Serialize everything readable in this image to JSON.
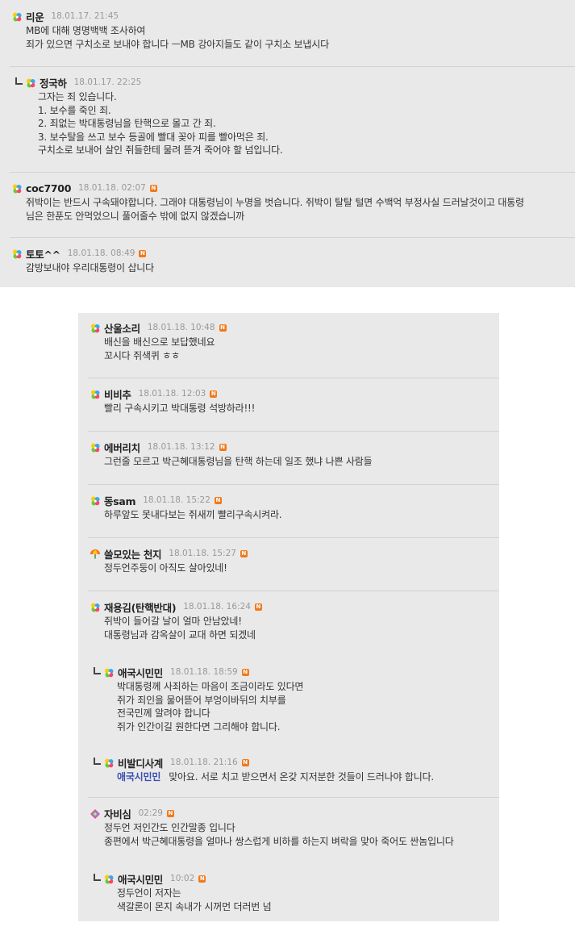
{
  "panel_top": {
    "comments": [
      {
        "nick": "리운",
        "date": "18.01.17. 21:45",
        "new": false,
        "badge": "badge-rainbow-icon",
        "lines": [
          "MB에 대해 명명백백 조사하여",
          "죄가 있으면 구치소로 보내야 합니다 ㅡMB 강아지들도 같이 구치소 보냅시다"
        ]
      },
      {
        "nick": "정국하",
        "date": "18.01.17. 22:25",
        "new": false,
        "badge": "badge-rainbow-icon",
        "reply": true,
        "lines": [
          "그자는 죄 있습니다.",
          "1. 보수를 죽인 죄.",
          "2. 죄없는 박대통령님을 탄핵으로 몰고 간 죄.",
          "3. 보수탈을 쓰고 보수 등골에 빨대 꽂아 피를 빨아먹은 죄.",
          "구치소로 보내어 살인 쥐들한테 물려 뜯겨 죽어야 할 넘입니다."
        ]
      },
      {
        "nick": "coc7700",
        "date": "18.01.18. 02:07",
        "new": true,
        "badge": "badge-rainbow-icon",
        "lines": [
          "쥐박이는 반드시 구속돼야합니다. 그래야 대통령님이 누명을 벗습니다. 쥐박이 탈탈 털면 수백억 부정사실 드러날것이고 대통령",
          "님은 한푼도 안먹었으니 풀어줄수 밖에 없지 않겠습니까"
        ]
      },
      {
        "nick": "토토^^",
        "date": "18.01.18. 08:49",
        "new": true,
        "badge": "badge-rainbow-icon",
        "lines": [
          "감방보내야 우리대통령이 삽니다"
        ]
      }
    ]
  },
  "panel_bottom": {
    "comments": [
      {
        "nick": "산울소리",
        "date": "18.01.18. 10:48",
        "new": true,
        "badge": "badge-rainbow-icon",
        "lines": [
          "배신을 배신으로 보답했네요",
          "꼬시다 쥐색퀴 ㅎㅎ"
        ]
      },
      {
        "nick": "비비추",
        "date": "18.01.18. 12:03",
        "new": true,
        "badge": "badge-rainbow-icon",
        "lines": [
          "빨리 구속시키고 박대통령 석방하라!!!"
        ]
      },
      {
        "nick": "에버리치",
        "date": "18.01.18. 13:12",
        "new": true,
        "badge": "badge-rainbow-icon",
        "lines": [
          "그런줄 모르고 박근혜대통령님을 탄핵 하는데 일조 했냐 나쁜 사람들"
        ]
      },
      {
        "nick": "동sam",
        "date": "18.01.18. 15:22",
        "new": true,
        "badge": "badge-rainbow-icon",
        "lines": [
          "하루앞도 못내다보는 쥐새끼 빨리구속시켜라."
        ]
      },
      {
        "nick": "쓸모있는 천지",
        "date": "18.01.18. 15:27",
        "new": true,
        "badge": "badge-umbrella-icon",
        "lines": [
          "정두언주둥이 아직도 살아있네!"
        ]
      },
      {
        "nick": "재용김(탄핵반대)",
        "date": "18.01.18. 16:24",
        "new": true,
        "badge": "badge-rainbow-icon",
        "lines": [
          "쥐박이 들어갈 날이 얼마 안남았네!",
          "대통령님과 감옥살이 교대 하면 되겠네"
        ]
      },
      {
        "nick": "애국시민민",
        "date": "18.01.18. 18:59",
        "new": true,
        "badge": "badge-rainbow-icon",
        "reply": true,
        "lines": [
          "박대통령께 사죄하는 마음이 조금이라도 있다면",
          "쥐가 죄인을 물어뜯어 부엉이바뒤의 치부를",
          "전국민께 알려야 합니다",
          "쥐가 인간이길 원한다면 그리해야 합니다."
        ]
      },
      {
        "nick": "비발디사계",
        "date": "18.01.18. 21:16",
        "new": true,
        "badge": "badge-rainbow-icon",
        "reply": true,
        "mention": "애국시민민",
        "lines": [
          "맞아요. 서로 치고 받으면서 온갖 지저분한 것들이 드러나야 합니다."
        ]
      },
      {
        "nick": "자비심",
        "date": "02:29",
        "new": true,
        "badge": "badge-diamond-icon",
        "lines": [
          "정두언 저인간도 인간말종 입니다",
          "종편에서 박근혜대통령을 얼마나 쌍스럽게 비하를 하는지 벼락을 맞아 죽어도 싼놈입니다"
        ]
      },
      {
        "nick": "애국시민민",
        "date": "10:02",
        "new": true,
        "badge": "badge-rainbow-icon",
        "reply": true,
        "lines": [
          "정두언이 저자는",
          "색갈론이 몬지 속내가 시꺼먼 더러번 넘"
        ]
      }
    ]
  },
  "new_badge_text": "N",
  "colors": {
    "panel": "#e9e9e9",
    "new_badge": "#f07a1a",
    "mention": "#3a4fb2"
  }
}
